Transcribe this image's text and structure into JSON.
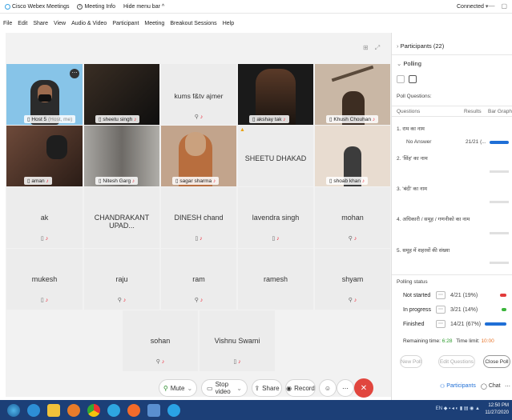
{
  "titlebar": {
    "app_name": "Cisco Webex Meetings",
    "meeting_info": "Meeting Info",
    "hide_menu": "Hide menu bar",
    "connection": "Connected"
  },
  "menu": [
    "File",
    "Edit",
    "Share",
    "View",
    "Audio & Video",
    "Participant",
    "Meeting",
    "Breakout Sessions",
    "Help"
  ],
  "video_tiles": [
    {
      "name": "Host 5",
      "suffix": "(Host, me)"
    },
    {
      "name": "sheetu singh"
    },
    {
      "name": "kums f&tv ajmer"
    },
    {
      "name": "akshay tak"
    },
    {
      "name": "Khush Chouhan"
    },
    {
      "name": "aman"
    },
    {
      "name": "Nitesh Garg"
    },
    {
      "name": "sagar sharma"
    },
    {
      "name": "SHEETU DHAKAD"
    },
    {
      "name": "shoab khan"
    },
    {
      "name": "ak"
    },
    {
      "name": "CHANDRAKANT UPAD..."
    },
    {
      "name": "DINESH chand"
    },
    {
      "name": "lavendra singh"
    },
    {
      "name": "mohan"
    },
    {
      "name": "mukesh"
    },
    {
      "name": "raju"
    },
    {
      "name": "ram"
    },
    {
      "name": "ramesh"
    },
    {
      "name": "shyam"
    },
    {
      "name": "sohan"
    },
    {
      "name": "Vishnu Swami"
    }
  ],
  "controls": {
    "mute": "Mute",
    "stop_video": "Stop video",
    "share": "Share",
    "record": "Record",
    "participants": "Participants",
    "chat": "Chat"
  },
  "panel": {
    "participants_header": "Participants (22)",
    "polling_header": "Polling",
    "poll_questions_label": "Poll Questions:",
    "col_questions": "Questions",
    "col_results": "Results",
    "col_bar": "Bar Graph",
    "questions": [
      {
        "text": "1. राम का नाम",
        "answer_label": "No Answer",
        "result": "21/21 (..."
      },
      {
        "text": "2. 'सिंह' का नाम"
      },
      {
        "text": "3. 'बंदी' का नाम"
      },
      {
        "text": "4. अधिकारी / समूह / गणनीको का नाम"
      },
      {
        "text": "5. समूह में शहरवों की संख्या"
      }
    ],
    "polling_status_label": "Polling status",
    "status": [
      {
        "label": "Not started",
        "value": "4/21 (19%)",
        "color": "#e23b3b",
        "fraction": 0.19
      },
      {
        "label": "In progress",
        "value": "3/21 (14%)",
        "color": "#3bb53b",
        "fraction": 0.14
      },
      {
        "label": "Finished",
        "value": "14/21 (67%)",
        "color": "#1f6fd6",
        "fraction": 0.67
      }
    ],
    "remaining_label": "Remaining time:",
    "remaining_value": "6:28",
    "limit_label": "Time limit:",
    "limit_value": "10:00",
    "btn_new": "New Poll",
    "btn_edit": "Edit Questions",
    "btn_close": "Close Poll"
  },
  "taskbar": {
    "time": "12:50 PM",
    "date": "11/27/2020"
  },
  "colors": {
    "accent": "#1f6fd6",
    "end_call": "#e1463e",
    "taskbar": "#1c3f77"
  }
}
